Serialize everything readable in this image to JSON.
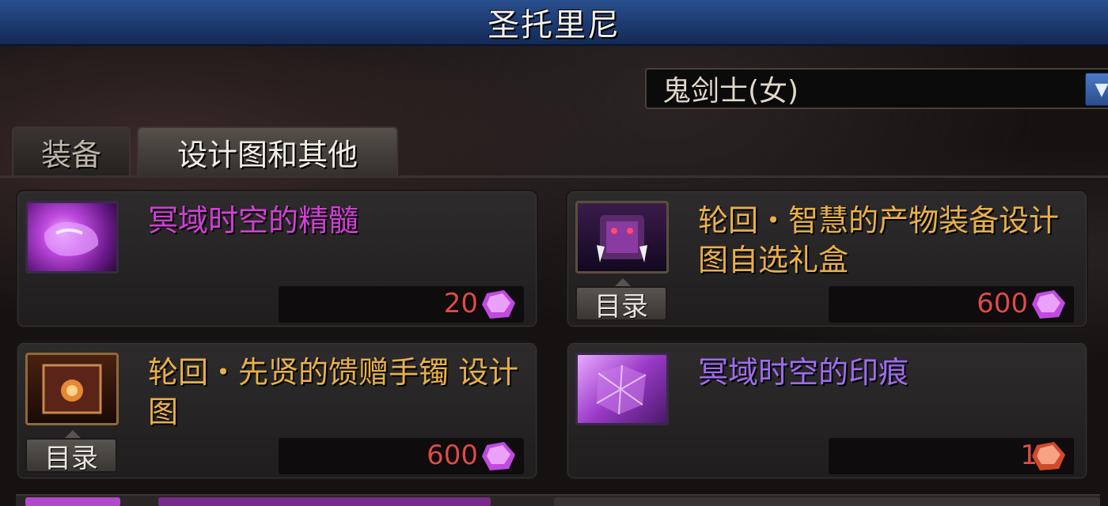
{
  "window": {
    "title": "圣托里尼"
  },
  "class_select": {
    "value": "鬼剑士(女)",
    "arrow_icon": "chevron-down-icon"
  },
  "tabs": [
    {
      "label": "装备",
      "active": false
    },
    {
      "label": "设计图和其他",
      "active": true
    }
  ],
  "items": [
    {
      "name": "冥域时空的精髓",
      "name_color": "#d23fd6",
      "icon": "purple-crystal-essence-icon",
      "price": "20",
      "currency_icon": "purple-gem-icon",
      "catalog": ""
    },
    {
      "name": "轮回・智慧的产物装备设计图自选礼盒",
      "name_color": "#e8b04a",
      "icon": "dark-gift-box-icon",
      "price": "600",
      "currency_icon": "purple-gem-icon",
      "catalog": "目录"
    },
    {
      "name": "轮回・先贤的馈赠手镯 设计图",
      "name_color": "#e8b04a",
      "icon": "blueprint-scroll-icon",
      "price": "600",
      "currency_icon": "purple-gem-icon",
      "catalog": "目录"
    },
    {
      "name": "冥域时空的印痕",
      "name_color": "#a06cf0",
      "icon": "cracked-purple-crystal-icon",
      "price": "1",
      "currency_icon": "red-gem-icon",
      "catalog": ""
    }
  ]
}
